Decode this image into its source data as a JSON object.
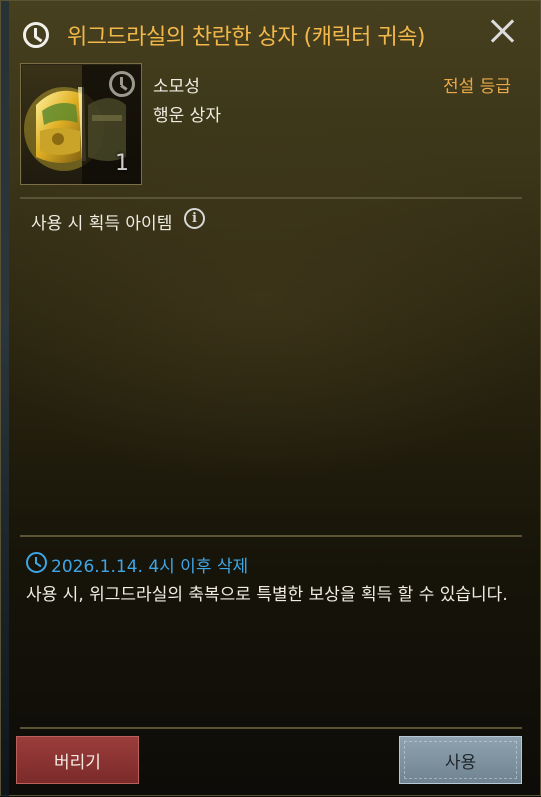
{
  "header": {
    "title": "위그드라실의 찬란한 상자 (캐릭터 귀속)",
    "clock_icon": "clock-icon",
    "close_icon": "close-icon"
  },
  "item": {
    "icon": "treasure-chest-icon",
    "timer_icon": "clock-icon",
    "count": "1",
    "category": "소모성",
    "name": "행운 상자",
    "grade": "전설 등급"
  },
  "contents": {
    "label": "사용 시 획득 아이템",
    "info_icon": "i"
  },
  "expiry": {
    "icon": "clock-icon",
    "text": "2026.1.14. 4시 이후 삭제"
  },
  "description": "사용 시, 위그드라실의 축복으로 특별한 보상을 획득 할 수 있습니다.",
  "buttons": {
    "discard": "버리기",
    "use": "사용"
  },
  "colors": {
    "title": "#f2b84a",
    "grade": "#e9a94a",
    "expiry": "#3fa6e6",
    "discard_button": "#8a3434",
    "use_button": "#7f93a0"
  }
}
